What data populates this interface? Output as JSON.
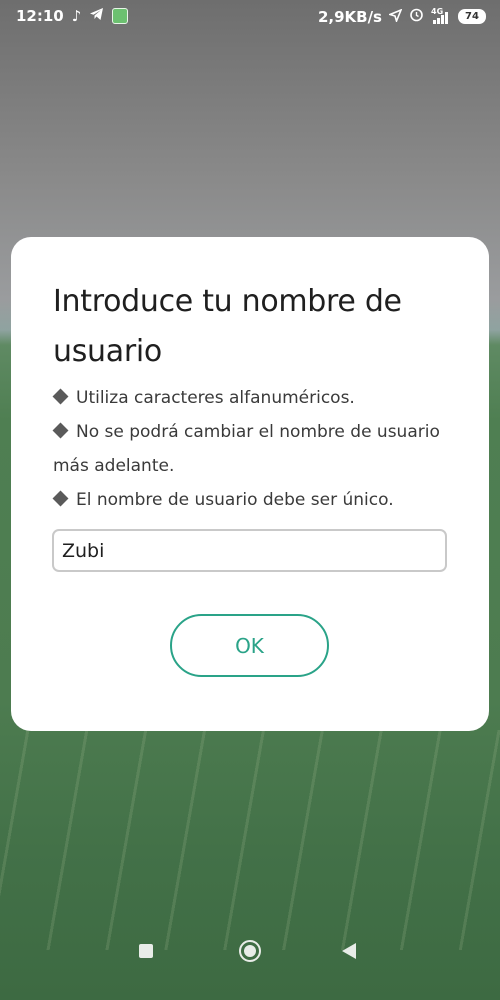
{
  "status_bar": {
    "time": "12:10",
    "network_speed": "2,9KB/s",
    "network_type": "4G",
    "battery": "74",
    "icons": [
      "tiktok-icon",
      "telegram-icon",
      "app-notification-icon",
      "location-arrow-icon",
      "alarm-icon",
      "signal-icon",
      "battery-icon"
    ]
  },
  "dialog": {
    "title": "Introduce tu nombre de usuario",
    "rules": [
      "Utiliza caracteres alfanuméricos.",
      "No se podrá cambiar el nombre de usuario más adelante.",
      "El nombre de usuario debe ser único."
    ],
    "input_value": "Zubi",
    "ok_label": "OK",
    "accent_color": "#2aa388"
  },
  "nav_bar": {
    "icons": [
      "recents-square-icon",
      "home-circle-icon",
      "back-triangle-icon"
    ]
  }
}
